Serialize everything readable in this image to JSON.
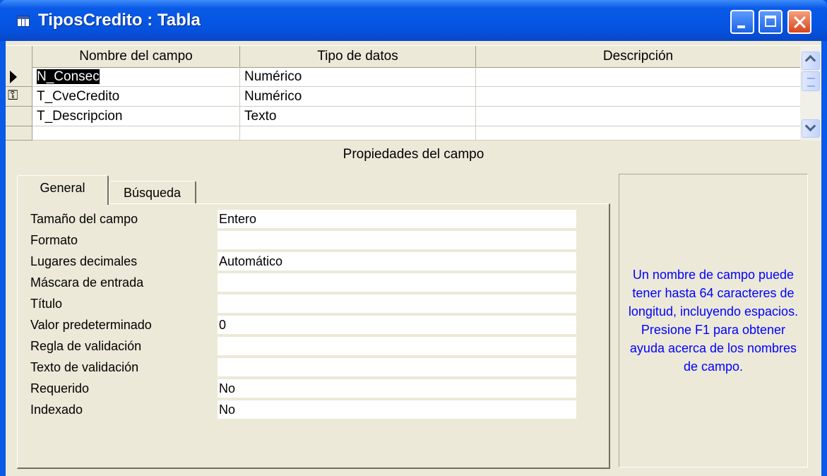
{
  "window": {
    "title": "TiposCredito : Tabla"
  },
  "grid": {
    "columns": [
      "Nombre del campo",
      "Tipo de datos",
      "Descripción"
    ],
    "rows": [
      {
        "indicator": "current",
        "name": "N_Consec",
        "type": "Numérico",
        "description": ""
      },
      {
        "indicator": "key",
        "name": "T_CveCredito",
        "type": "Numérico",
        "description": ""
      },
      {
        "indicator": "",
        "name": "T_Descripcion",
        "type": "Texto",
        "description": ""
      },
      {
        "indicator": "",
        "name": "",
        "type": "",
        "description": ""
      }
    ]
  },
  "properties": {
    "section_title": "Propiedades del campo",
    "tabs": [
      "General",
      "Búsqueda"
    ],
    "active_tab": "General",
    "items": [
      {
        "label": "Tamaño del campo",
        "value": "Entero"
      },
      {
        "label": "Formato",
        "value": ""
      },
      {
        "label": "Lugares decimales",
        "value": "Automático"
      },
      {
        "label": "Máscara de entrada",
        "value": ""
      },
      {
        "label": "Título",
        "value": ""
      },
      {
        "label": "Valor predeterminado",
        "value": "0"
      },
      {
        "label": "Regla de validación",
        "value": ""
      },
      {
        "label": "Texto de validación",
        "value": ""
      },
      {
        "label": "Requerido",
        "value": "No"
      },
      {
        "label": "Indexado",
        "value": "No"
      }
    ]
  },
  "help": {
    "text": "Un nombre de campo puede tener hasta 64 caracteres de longitud, incluyendo espacios. Presione F1 para obtener ayuda acerca de los nombres de campo.",
    "color": "#0000ff"
  },
  "icons": {
    "window": "table-icon",
    "current_row": "current-row-arrow-icon",
    "primary_key": "primary-key-icon"
  }
}
